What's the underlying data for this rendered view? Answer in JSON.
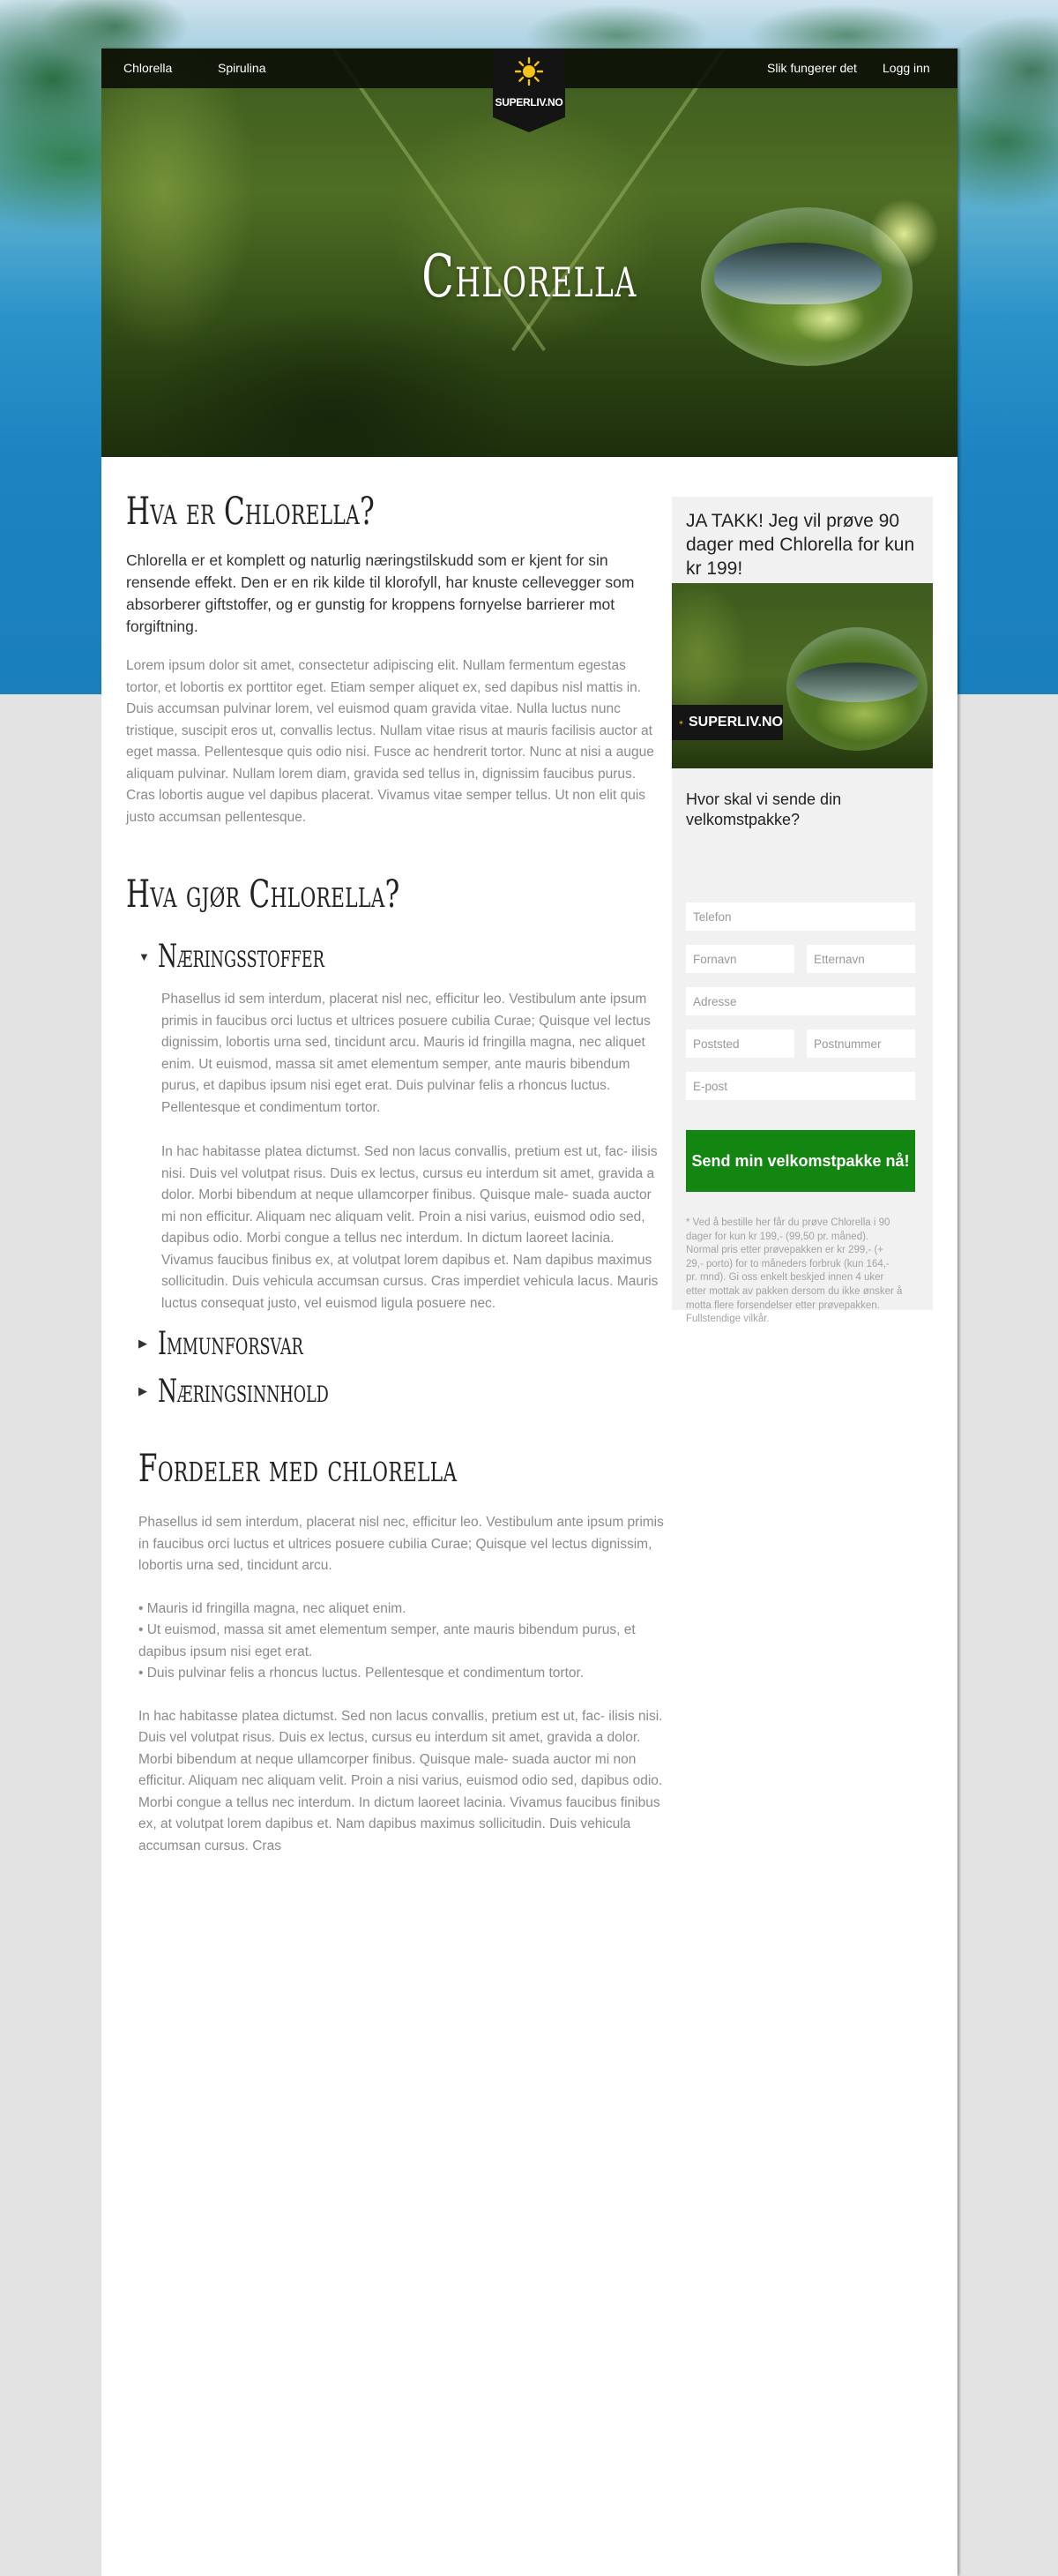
{
  "nav": {
    "left": [
      "Chlorella",
      "Spirulina"
    ],
    "right": [
      "Slik fungerer det",
      "Logg inn"
    ],
    "logo_text": "SUPERLIV.NO"
  },
  "hero": {
    "title": "Chlorella"
  },
  "section1": {
    "title": "Hva er Chlorella?",
    "lead": "Chlorella er et komplett og naturlig næringstilskudd som er kjent for sin rensende effekt. Den er en rik kilde til klorofyll, har knuste cellevegger som absorberer giftstoffer, og er gunstig for kroppens fornyelse barrierer mot forgiftning.",
    "body": "Lorem ipsum dolor sit amet, consectetur adipiscing elit. Nullam fermentum egestas tortor, et lobortis ex porttitor eget. Etiam semper aliquet ex, sed dapibus nisl mattis in. Duis accumsan pulvinar lorem, vel euismod quam gravida vitae. Nulla luctus nunc tristique, suscipit eros ut, convallis lectus. Nullam vitae risus at mauris facilisis auctor at eget massa. Pellentesque quis odio nisi. Fusce ac hendrerit tortor. Nunc at nisi a augue aliquam pulvinar. Nullam lorem diam, gravida sed tellus in, dignissim faucibus purus. Cras lobortis augue vel dapibus placerat. Vivamus vitae semper tellus. Ut non elit quis justo accumsan pellentesque."
  },
  "section2": {
    "title": "Hva gjør Chlorella?",
    "accordion": [
      {
        "title": "Næringsstoffer",
        "expanded": true,
        "p1": "Phasellus id sem interdum, placerat nisl nec, efficitur leo. Vestibulum ante ipsum primis in faucibus orci luctus et ultrices posuere cubilia Curae; Quisque vel lectus dignissim, lobortis urna sed, tincidunt arcu. Mauris id fringilla magna, nec aliquet enim. Ut euismod, massa sit amet elementum semper, ante mauris bibendum purus, et dapibus ipsum nisi eget erat. Duis pulvinar felis a rhoncus luctus. Pellentesque et condimentum tortor.",
        "p2": "In hac habitasse platea dictumst. Sed non lacus convallis, pretium est ut, fac- ilisis nisi. Duis vel volutpat risus. Duis ex lectus, cursus eu interdum sit amet, gravida a dolor. Morbi bibendum at neque ullamcorper finibus. Quisque male- suada auctor mi non efficitur. Aliquam nec aliquam velit. Proin a nisi varius, euismod odio sed, dapibus odio. Morbi congue a tellus nec interdum. In dictum laoreet lacinia. Vivamus faucibus finibus ex, at volutpat lorem dapibus et. Nam dapibus maximus sollicitudin. Duis vehicula accumsan cursus. Cras imperdiet vehicula lacus. Mauris luctus consequat justo, vel euismod ligula posuere nec."
      },
      {
        "title": "Immunforsvar",
        "expanded": false
      },
      {
        "title": "Næringsinnhold",
        "expanded": false
      }
    ]
  },
  "section3": {
    "title": "Fordeler med chlorella",
    "p1": "Phasellus id sem interdum, placerat nisl nec, efficitur leo. Vestibulum ante ipsum primis in faucibus orci luctus et ultrices posuere cubilia Curae; Quisque vel lectus dignissim, lobortis urna sed, tincidunt arcu.",
    "bullets": [
      "• Mauris id fringilla magna, nec aliquet enim.",
      "• Ut euismod, massa sit amet elementum semper, ante mauris bibendum purus, et dapibus ipsum nisi eget erat.",
      "• Duis pulvinar felis a rhoncus luctus. Pellentesque et condimentum tortor."
    ],
    "p2": "In hac habitasse platea dictumst. Sed non lacus convallis, pretium est ut, fac- ilisis nisi. Duis vel volutpat risus. Duis ex lectus, cursus eu interdum sit amet, gravida a dolor. Morbi bibendum at neque ullamcorper finibus. Quisque male- suada auctor mi non efficitur. Aliquam nec aliquam velit. Proin a nisi varius, euismod odio sed, dapibus odio. Morbi congue a tellus nec interdum. In dictum laoreet lacinia. Vivamus faucibus finibus ex, at volutpat lorem dapibus et. Nam dapibus maximus sollicitudin. Duis vehicula accumsan cursus. Cras"
  },
  "sidebar": {
    "offer": "JA TAKK! Jeg vil prøve 90 dager med Chlorella for kun kr 199!",
    "badge": "SUPERLIV.NO",
    "form_title": "Hvor skal vi sende din velkomstpakke?",
    "placeholders": {
      "phone": "Telefon",
      "first_name": "Fornavn",
      "last_name": "Etternavn",
      "address": "Adresse",
      "city": "Poststed",
      "zip": "Postnummer",
      "email": "E-post"
    },
    "cta": "Send min velkomstpakke nå!",
    "disclaimer": "* Ved å bestille her får du prøve Chlorella i 90 dager for kun kr 199,- (99,50 pr. måned). Normal pris etter prøvepakken er kr 299,- (+ 29,- porto) for to måneders forbruk (kun 164,- pr. mnd). Gi oss enkelt beskjed innen 4 uker etter mottak av pakken dersom du ikke ønsker å motta flere forsendelser etter prøvepakken. Fullstendige vilkår."
  },
  "colors": {
    "cta": "#138612",
    "nav_bg": "#0a0e06",
    "sidebar_bg": "#f1f1f1",
    "sky": "#1d84c0"
  },
  "icons": [
    "sun-logo-icon",
    "triangle-down-icon",
    "triangle-right-icon"
  ]
}
